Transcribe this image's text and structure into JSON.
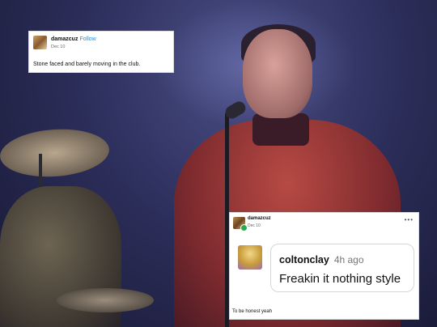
{
  "top_post": {
    "username": "damazcuz",
    "follow_label": "Follow",
    "date": "Dec 10",
    "body": "Stone faced and barely moving in the club."
  },
  "reply_post": {
    "username": "damazcuz",
    "date": "Dec 10",
    "more_label": "•••",
    "reply": {
      "username": "coltonclay",
      "time": "4h ago",
      "text": "Freakin it nothing style"
    },
    "body": "To be honest yeah"
  },
  "colors": {
    "follow_link": "#1f8fe0",
    "online_badge": "#2fa84f",
    "uniform_red": "#b74a43",
    "stage_blue": "#2d2f5c"
  },
  "icons": [
    "avatar-image",
    "online-badge-icon",
    "more-options-icon"
  ]
}
